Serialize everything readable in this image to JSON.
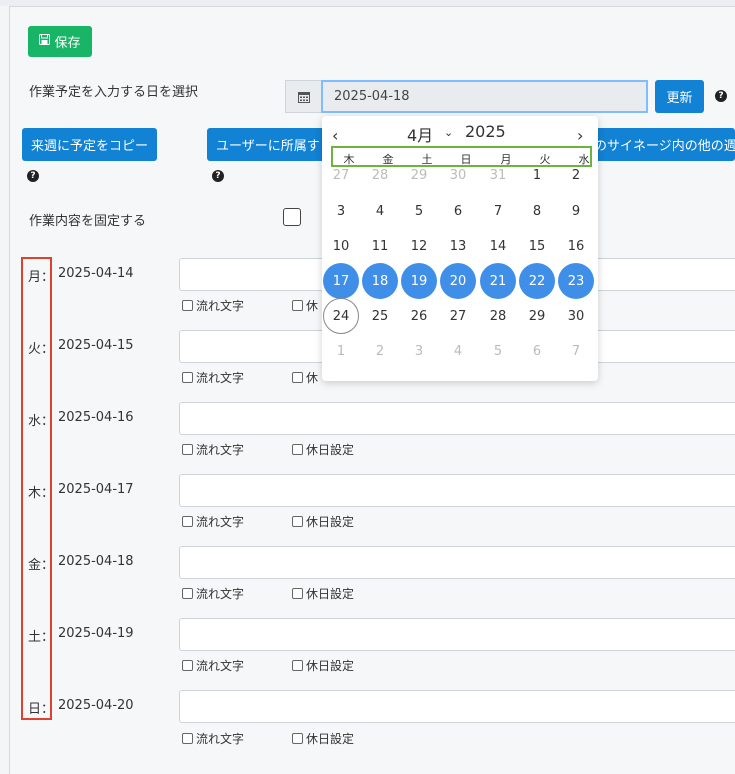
{
  "toolbar": {
    "save_label": "保存"
  },
  "date_select": {
    "label": "作業予定を入力する日を選択",
    "value": "2025-04-18",
    "update_label": "更新"
  },
  "help_symbol": "?",
  "actions": {
    "copy_next_week": "来週に予定をコピー",
    "user_belong": "ユーザーに所属す",
    "signage_other": "のサイネージ内の他の週"
  },
  "fix_label": "作業内容を固定する",
  "checkbox_labels": {
    "flow_text": "流れ文字",
    "holiday": "休日設定",
    "holiday_partial": "休"
  },
  "days": [
    {
      "weekday": "月",
      "sep": "：",
      "date": "2025-04-14"
    },
    {
      "weekday": "火",
      "sep": "：",
      "date": "2025-04-15"
    },
    {
      "weekday": "水",
      "sep": "：",
      "date": "2025-04-16"
    },
    {
      "weekday": "木",
      "sep": "：",
      "date": "2025-04-17"
    },
    {
      "weekday": "金",
      "sep": "：",
      "date": "2025-04-18"
    },
    {
      "weekday": "土",
      "sep": "：",
      "date": "2025-04-19"
    },
    {
      "weekday": "日",
      "sep": "：",
      "date": "2025-04-20"
    }
  ],
  "datepicker": {
    "prev": "‹",
    "next": "›",
    "month": "4月",
    "month_chevron": "⌄",
    "year": "2025",
    "weekdays": [
      "木",
      "金",
      "土",
      "日",
      "月",
      "火",
      "水"
    ],
    "weeks": [
      [
        "27",
        "28",
        "29",
        "30",
        "31",
        "1",
        "2"
      ],
      [
        "3",
        "4",
        "5",
        "6",
        "7",
        "8",
        "9"
      ],
      [
        "10",
        "11",
        "12",
        "13",
        "14",
        "15",
        "16"
      ],
      [
        "17",
        "18",
        "19",
        "20",
        "21",
        "22",
        "23"
      ],
      [
        "24",
        "25",
        "26",
        "27",
        "28",
        "29",
        "30"
      ],
      [
        "1",
        "2",
        "3",
        "4",
        "5",
        "6",
        "7"
      ]
    ]
  }
}
